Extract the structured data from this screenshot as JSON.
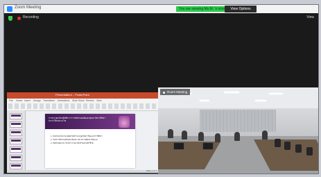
{
  "window": {
    "title": "Zoom Meeting"
  },
  "banner": {
    "text": "You are viewing Ms.M. 's screen",
    "view_options": "View Options"
  },
  "topbar": {
    "recording_label": "Recording",
    "view_label": "View"
  },
  "presentation": {
    "file_title": "Presentation1 - PowerPoint",
    "tabs": [
      "File",
      "Home",
      "Insert",
      "Design",
      "Transitions",
      "Animations",
      "Slide Show",
      "Review",
      "View"
    ],
    "slide_title": "การประชุมเชิงปฏิบัติการ การจัดทำแผนพัฒนาคุณภาพการศึกษา ประจำปีงบประมาณ",
    "bullets": [
      "1. ทบทวนนโยบาย ยุทธศาสตร์ และจุดเน้นการพัฒนาการศึกษา",
      "2. วิเคราะห์สภาพปัจจุบัน ปัญหา และความต้องการพัฒนา",
      "3. จัดทำแผนงาน โครงการ และกิจกรรมตามตัวชี้วัด"
    ],
    "status": "Slide 1 of 7"
  },
  "video": {
    "participant_name": "Room Meeting"
  },
  "colors": {
    "zoom_blue": "#2d8cff",
    "banner_green": "#2bc94b",
    "record_red": "#e03131",
    "ppt_red": "#c74a2b",
    "slide_purple": "#5b2e6e"
  }
}
